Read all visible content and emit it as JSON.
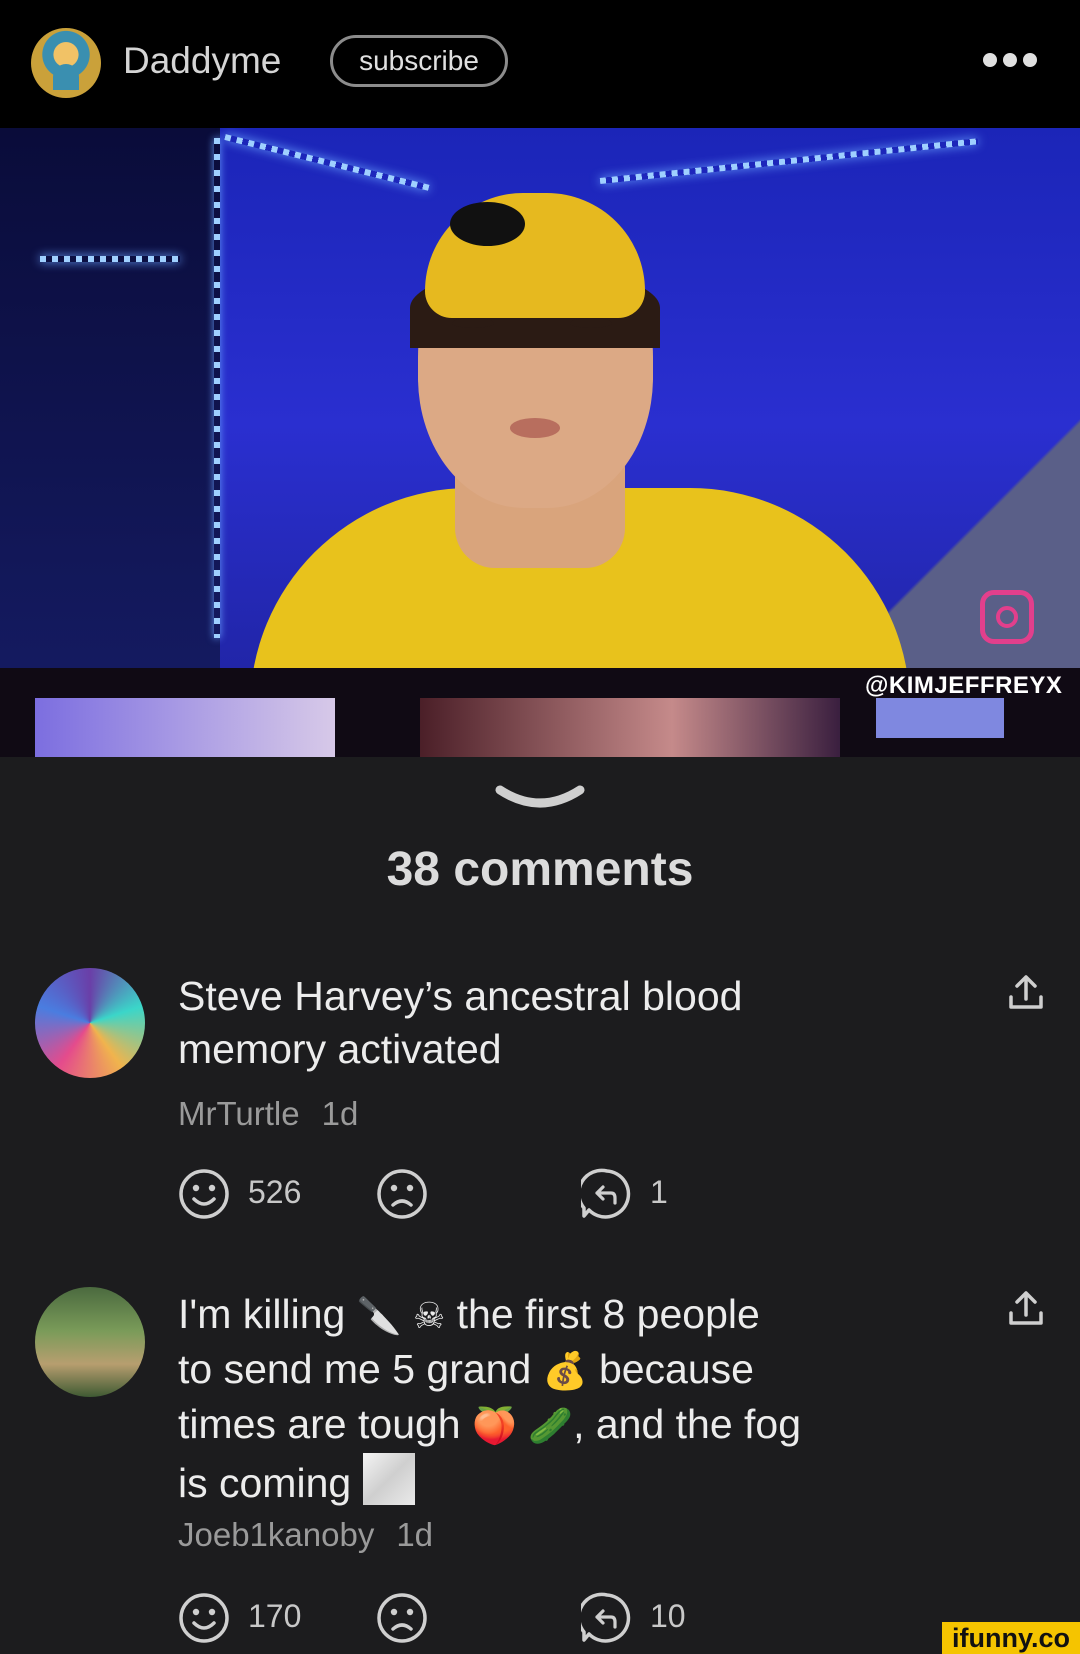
{
  "header": {
    "author_name": "Daddyme",
    "subscribe_label": "subscribe",
    "more_icon": "more-dots-icon"
  },
  "video": {
    "watermark_handle": "@KIMJEFFREYX",
    "social_icon": "instagram-icon"
  },
  "comments_section": {
    "count_label": "38 comments",
    "collapse_icon": "chevron-down-icon"
  },
  "comments": [
    {
      "text_line1": "Steve Harvey’s ancestral blood",
      "text_line2": "memory activated",
      "username": "MrTurtle",
      "age": "1d",
      "smile_count": "526",
      "frown_count": "",
      "reply_count": "1"
    },
    {
      "text_part1": "I'm killing",
      "emoji_knife": "🔪",
      "emoji_skull": "☠",
      "text_part2": "the first 8 people",
      "text_part3": "to send me 5 grand",
      "emoji_money": "💰",
      "text_part4": "because",
      "text_part5": "times are tough",
      "emoji_peach": "🍑",
      "emoji_cucumber": "🥒",
      "text_part6": ", and the fog",
      "text_part7": "is coming",
      "username": "Joeb1kanoby",
      "age": "1d",
      "smile_count": "170",
      "frown_count": "",
      "reply_count": "10"
    }
  ],
  "footer": {
    "site_watermark": "ifunny.co"
  },
  "colors": {
    "background": "#1c1c1e",
    "topbar": "#000000",
    "watermark_bg": "#f5c400"
  }
}
